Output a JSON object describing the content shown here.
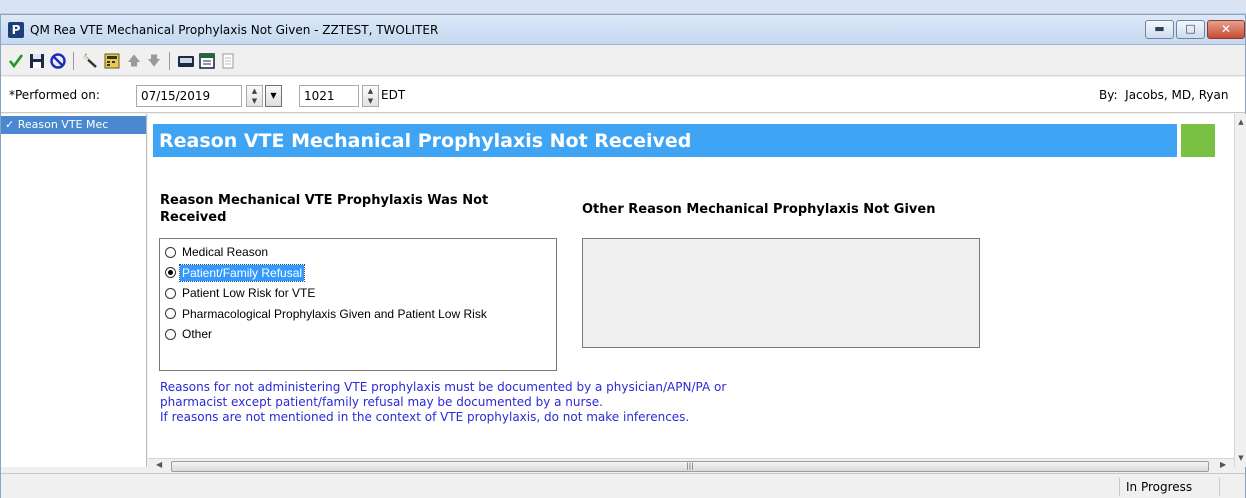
{
  "window": {
    "title": "QM Rea VTE Mechanical Prophylaxis Not Given - ZZTEST, TWOLITER",
    "app_icon_letter": "P"
  },
  "performed": {
    "label": "*Performed on:",
    "date": "07/15/2019",
    "time": "1021",
    "timezone": "EDT",
    "by_label": "By:",
    "by_name": "Jacobs, MD, Ryan"
  },
  "navigator": {
    "items": [
      {
        "label": "Reason VTE Mec",
        "checked": true
      }
    ]
  },
  "section": {
    "title": "Reason VTE Mechanical Prophylaxis Not Received",
    "header_color": "#3ea4f3",
    "status_color": "#78c142"
  },
  "question1": {
    "label": "Reason Mechanical VTE Prophylaxis Was Not Received",
    "options": [
      {
        "label": "Medical Reason",
        "selected": false
      },
      {
        "label": "Patient/Family Refusal",
        "selected": true
      },
      {
        "label": "Patient Low Risk for VTE",
        "selected": false
      },
      {
        "label": "Pharmacological Prophylaxis Given and Patient Low Risk",
        "selected": false
      },
      {
        "label": "Other",
        "selected": false
      }
    ]
  },
  "question2": {
    "label": "Other Reason Mechanical Prophylaxis Not Given",
    "value": ""
  },
  "note": {
    "line1": "Reasons for not administering VTE prophylaxis must be documented by a physician/APN/PA or pharmacist except patient/family refusal may be documented by a nurse.",
    "line2": "If reasons are not mentioned in the context of VTE prophylaxis, do not make inferences.",
    "color": "#2a2ad6"
  },
  "status": {
    "text": "In Progress"
  },
  "toolbar": {
    "icons": [
      "sign-checkmark-icon",
      "save-icon",
      "cancel-icon",
      "wand-icon",
      "calculator-form-icon",
      "up-arrow-icon",
      "down-arrow-icon",
      "keyboard-icon",
      "calendar-icon",
      "document-icon"
    ]
  }
}
